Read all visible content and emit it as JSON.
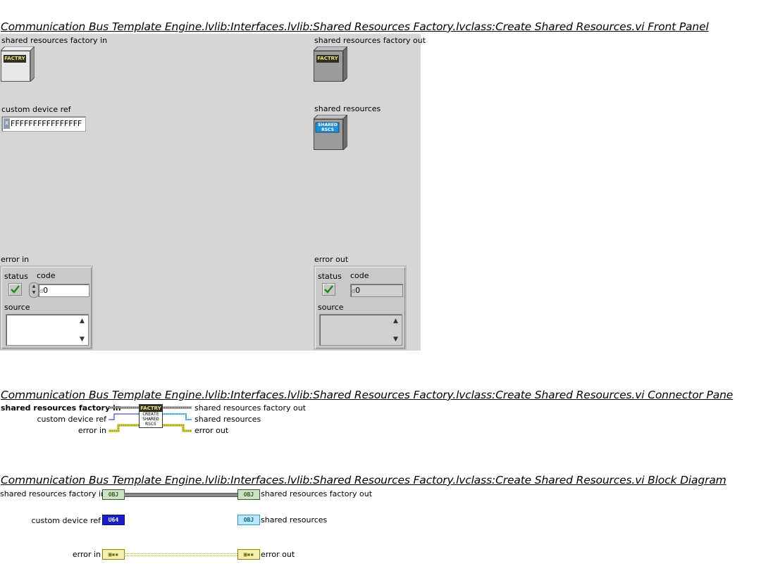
{
  "front_panel": {
    "title": "Communication Bus Template Engine.lvlib:Interfaces.lvlib:Shared Resources Factory.lvclass:Create Shared Resources.vi Front Panel",
    "factory_in_label": "shared resources factory in",
    "factory_in_icon_text": "FACTRY",
    "factory_out_label": "shared resources factory out",
    "factory_out_icon_text": "FACTRY",
    "custom_device_ref_label": "custom device ref",
    "custom_device_ref_value": "FFFFFFFFFFFFFFFF",
    "custom_device_ref_radix": "x",
    "shared_resources_label": "shared resources",
    "shared_resources_icon_text": "SHARED RSCS",
    "error_in": {
      "label": "error in",
      "status_label": "status",
      "code_label": "code",
      "code_value": "0",
      "code_radix": "d",
      "source_label": "source"
    },
    "error_out": {
      "label": "error out",
      "status_label": "status",
      "code_label": "code",
      "code_value": "0",
      "code_radix": "d",
      "source_label": "source"
    }
  },
  "connector_pane": {
    "title": "Communication Bus Template Engine.lvlib:Interfaces.lvlib:Shared Resources Factory.lvclass:Create Shared Resources.vi Connector Pane",
    "inputs": [
      "shared resources factory in",
      "custom device ref",
      "error in"
    ],
    "outputs": [
      "shared resources factory out",
      "shared resources",
      "error out"
    ],
    "icon_top_text": "FACTRY",
    "icon_line1": "CREATE",
    "icon_line2": "SHARED",
    "icon_line3": "RSCS"
  },
  "block_diagram": {
    "title": "Communication Bus Template Engine.lvlib:Interfaces.lvlib:Shared Resources Factory.lvclass:Create Shared Resources.vi Block Diagram",
    "factory_in_label": "shared resources factory in",
    "factory_in_term": "OBJ",
    "factory_out_label": "shared resources factory out",
    "factory_out_term": "OBJ",
    "custom_device_ref_label": "custom device ref",
    "custom_device_ref_term": "U64",
    "shared_resources_label": "shared resources",
    "shared_resources_term": "OBJ",
    "error_in_label": "error in",
    "error_in_term": "",
    "error_out_label": "error out",
    "error_out_term": ""
  },
  "colors": {
    "panel": "#d6d6d6",
    "class_wire": "#3b5a2f",
    "u64_wire": "#1c1cc8",
    "shared_wire": "#2a9ac8",
    "error_wire": "#a7a000"
  }
}
